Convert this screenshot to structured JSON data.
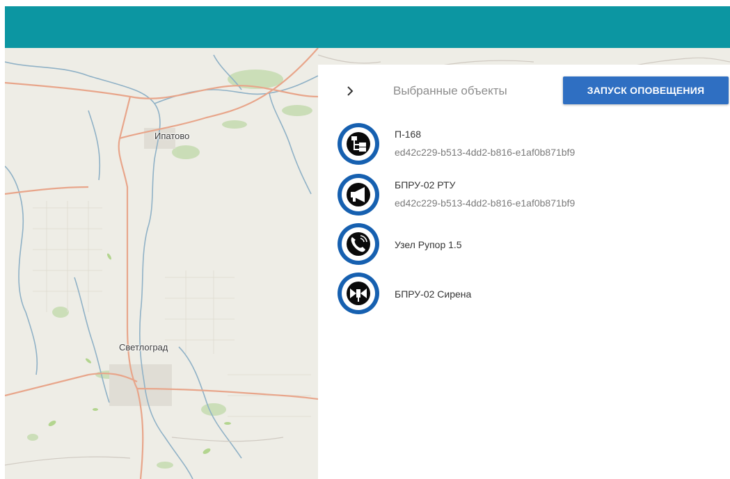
{
  "map": {
    "cities": [
      {
        "name": "Ипатово"
      },
      {
        "name": "Светлоград"
      }
    ]
  },
  "panel": {
    "collapse_icon": "chevron-right-icon",
    "title": "Выбранные объекты",
    "launch_button": "ЗАПУСК ОПОВЕЩЕНИЯ",
    "objects": [
      {
        "name": "П-168",
        "id": "ed42c229-b513-4dd2-b816-e1af0b871bf9",
        "icon": "network-tree-icon"
      },
      {
        "name": "БПРУ-02 РТУ",
        "id": "ed42c229-b513-4dd2-b816-e1af0b871bf9",
        "icon": "megaphone-icon"
      },
      {
        "name": "Узел Рупор 1.5",
        "icon": "phone-ringing-icon"
      },
      {
        "name": "БПРУ-02 Сирена",
        "icon": "siren-icon"
      }
    ]
  },
  "colors": {
    "header": "#0c96a2",
    "button": "#2f6fc2",
    "icon_ring": "#1660b0",
    "map_bg": "#eeede6",
    "river": "#8fb1c6",
    "road": "#e8a58a"
  }
}
